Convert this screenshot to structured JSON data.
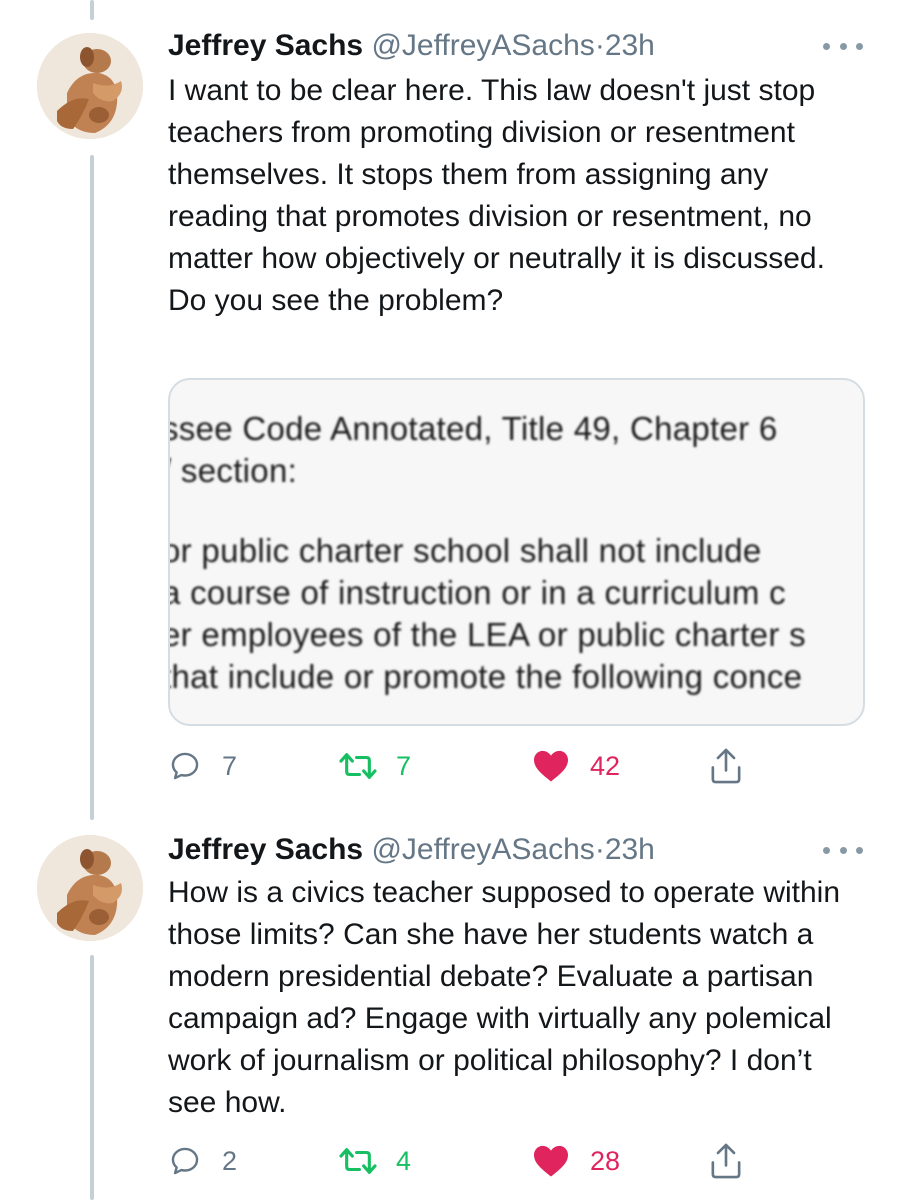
{
  "tweets": [
    {
      "author_name": "Jeffrey Sachs",
      "handle": "@JeffreyASachs",
      "separator": "·",
      "time": "23h",
      "text": "I want to be clear here. This law doesn't just stop teachers from promoting division or resentment themselves. It stops them from assigning any reading that promotes division or resentment, no matter how objectively or neutrally it is discussed. Do you see the problem?",
      "media": {
        "lines": [
          "ssee Code Annotated, Title 49, Chapter 6",
          "/ section:",
          "or public charter school shall not include",
          "a course of instruction or in a curriculum c",
          "er employees of the LEA or public charter s",
          " that include or promote the following conce"
        ]
      },
      "reply_count": "7",
      "retweet_count": "7",
      "like_count": "42"
    },
    {
      "author_name": "Jeffrey Sachs",
      "handle": "@JeffreyASachs",
      "separator": "·",
      "time": "23h",
      "text": "How is a civics teacher supposed to operate within those limits? Can she have her students watch a modern presidential debate? Evaluate a partisan campaign ad? Engage with virtually any polemical work of journalism or political philosophy? I don’t see how.",
      "reply_count": "2",
      "retweet_count": "4",
      "like_count": "28"
    }
  ],
  "colors": {
    "retweet": "#17bf63",
    "like": "#e0245e",
    "muted": "#657786",
    "thread_line": "#c4cfd6"
  },
  "icons": [
    "reply-icon",
    "retweet-icon",
    "heart-icon",
    "share-icon",
    "more-icon"
  ]
}
